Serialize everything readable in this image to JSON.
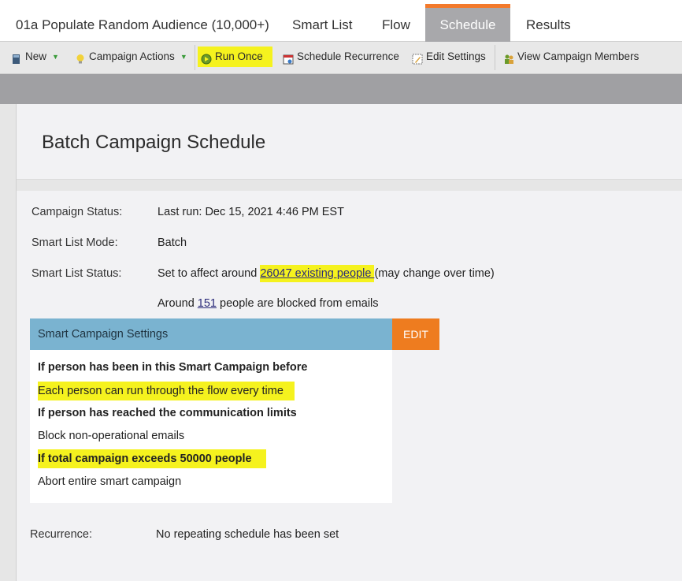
{
  "tabs": [
    {
      "label": "01a Populate Random Audience (10,000+)",
      "active": false
    },
    {
      "label": "Smart List",
      "active": false
    },
    {
      "label": "Flow",
      "active": false
    },
    {
      "label": "Schedule",
      "active": true
    },
    {
      "label": "Results",
      "active": false
    }
  ],
  "toolbar": {
    "new_label": "New",
    "campaign_actions_label": "Campaign Actions",
    "run_once_label": "Run Once",
    "schedule_recurrence_label": "Schedule Recurrence",
    "edit_settings_label": "Edit Settings",
    "view_members_label": "View Campaign Members"
  },
  "page": {
    "title": "Batch Campaign Schedule"
  },
  "status": {
    "campaign_status_label": "Campaign Status:",
    "campaign_status_value": "Last run: Dec 15, 2021 4:46 PM EST",
    "mode_label": "Smart List Mode:",
    "mode_value": "Batch",
    "list_status_label": "Smart List Status:",
    "list_status_prefix": "Set to affect around ",
    "list_status_link": "26047 existing people ",
    "list_status_suffix": "(may change over time)",
    "blocked_prefix": "Around ",
    "blocked_link": "151",
    "blocked_suffix": " people are blocked from emails"
  },
  "settings": {
    "header": "Smart Campaign Settings",
    "edit_label": "EDIT",
    "lines": [
      "If person has been in this Smart Campaign before",
      "Each person can run through the flow every time",
      "If person has reached the communication limits",
      "Block non-operational emails",
      "If total campaign exceeds 50000 people",
      "Abort entire smart campaign"
    ]
  },
  "recurrence": {
    "label": "Recurrence:",
    "value": "No repeating schedule has been set"
  },
  "colors": {
    "highlight": "#f5f21e",
    "tab_accent": "#f37a2b",
    "edit_button": "#ee7c1f",
    "settings_header": "#7ab3d0"
  }
}
